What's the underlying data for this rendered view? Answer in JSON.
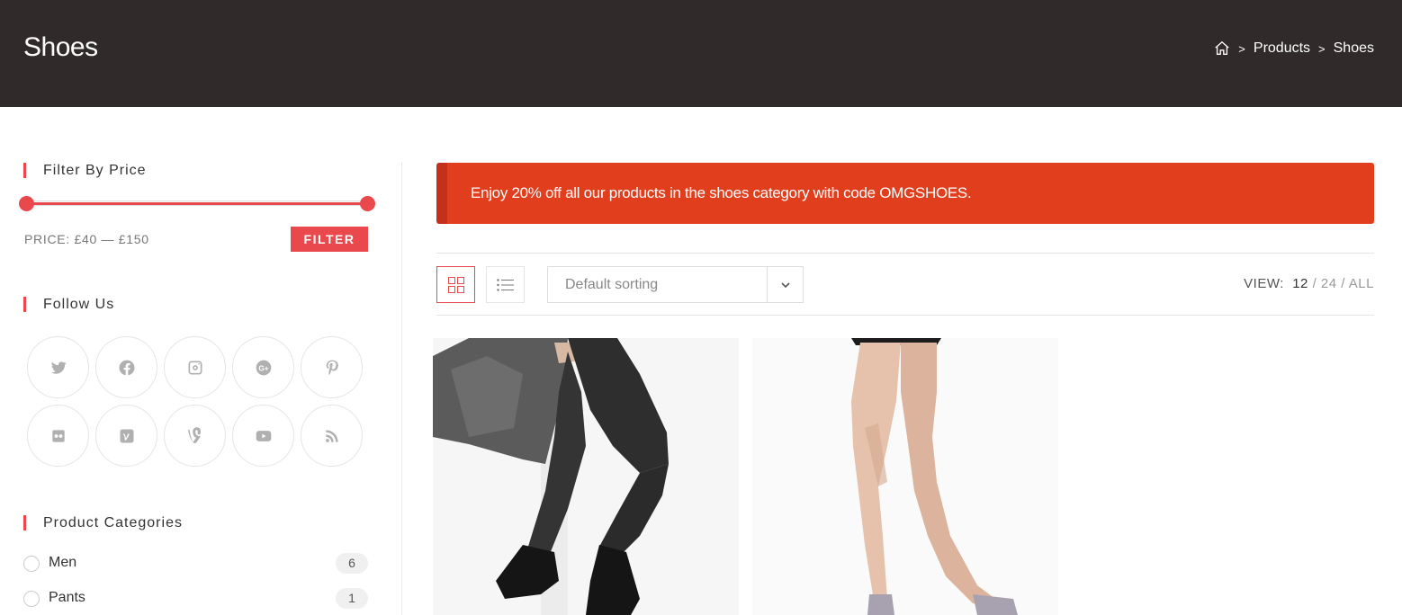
{
  "header": {
    "title": "Shoes",
    "breadcrumb": {
      "home_icon": "home-icon",
      "sep1": ">",
      "products": "Products",
      "sep2": ">",
      "current": "Shoes"
    }
  },
  "sidebar": {
    "filter": {
      "title": "Filter By Price",
      "price_label": "PRICE: £40 — £150",
      "button": "FILTER",
      "slider_min": 0,
      "slider_max": 1
    },
    "follow": {
      "title": "Follow Us",
      "icons": [
        "twitter-icon",
        "facebook-icon",
        "instagram-icon",
        "google-plus-icon",
        "pinterest-icon",
        "flickr-icon",
        "vimeo-icon",
        "vine-icon",
        "youtube-icon",
        "rss-icon"
      ]
    },
    "categories": {
      "title": "Product Categories",
      "items": [
        {
          "name": "Men",
          "count": "6"
        },
        {
          "name": "Pants",
          "count": "1"
        }
      ]
    }
  },
  "main": {
    "notice": "Enjoy 20% off all our products in the shoes category with code OMGSHOES.",
    "toolbar": {
      "grid_icon": "grid-view-icon",
      "list_icon": "list-view-icon",
      "sorting": "Default sorting",
      "view_label": "VIEW:",
      "view_12": "12",
      "view_24": "24",
      "view_all": "ALL",
      "slash": "/"
    },
    "products": [
      {
        "image": "man-jeans-boots-photo"
      },
      {
        "image": "woman-legs-heels-photo"
      }
    ]
  },
  "colors": {
    "header_bg": "#302a2a",
    "accent": "#e9494c",
    "notice_bg": "#e13e1d"
  }
}
